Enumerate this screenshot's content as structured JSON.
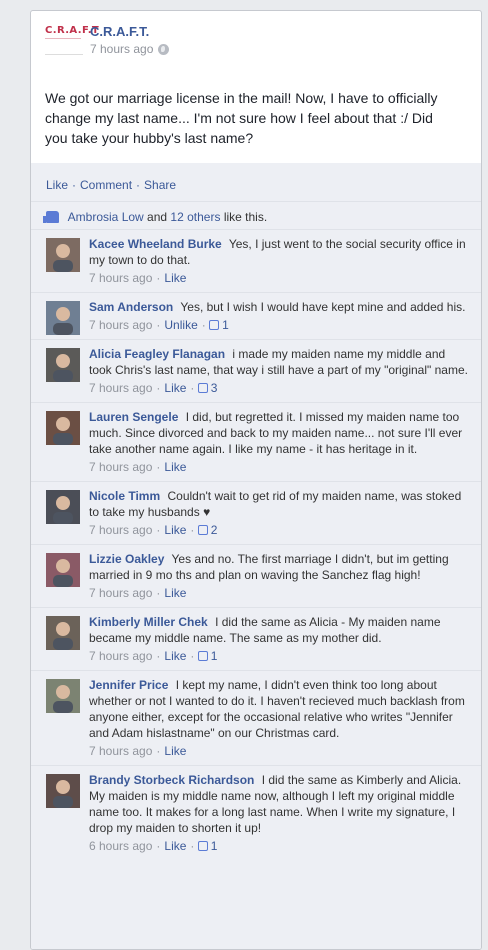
{
  "post": {
    "page_name": "C.R.A.F.T.",
    "logo_text": "C.R.A.F.T",
    "time": "7 hours ago",
    "text": "We got our marriage license in the mail! Now, I have to officially change my last name... I'm not sure how I feel about that :/ Did you take your hubby's last name?"
  },
  "actions": {
    "like": "Like",
    "comment": "Comment",
    "share": "Share",
    "dot": "·"
  },
  "likes": {
    "first": "Ambrosia Low",
    "and": "and",
    "others": "12 others",
    "suffix": "like this."
  },
  "comments": [
    {
      "name": "Kacee Wheeland Burke",
      "text": "Yes, I just went to the social security office in my town to do that.",
      "time": "7 hours ago",
      "action": "Like",
      "likes": ""
    },
    {
      "name": "Sam Anderson",
      "text": "Yes, but I wish I would have kept mine and added his.",
      "time": "7 hours ago",
      "action": "Unlike",
      "likes": "1"
    },
    {
      "name": "Alicia Feagley Flanagan",
      "text": "i made my maiden name my middle and took Chris's last name, that way i still have a part of my \"original\" name.",
      "time": "7 hours ago",
      "action": "Like",
      "likes": "3"
    },
    {
      "name": "Lauren Sengele",
      "text": "I did, but regretted it. I missed my maiden name too much. Since divorced and back to my maiden name... not sure I'll ever take another name again. I like my name - it has heritage in it.",
      "time": "7 hours ago",
      "action": "Like",
      "likes": ""
    },
    {
      "name": "Nicole Timm",
      "text": "Couldn't wait to get rid of my maiden name, was stoked to take my husbands ♥",
      "time": "7 hours ago",
      "action": "Like",
      "likes": "2"
    },
    {
      "name": "Lizzie Oakley",
      "text": "Yes and no. The first marriage I didn't, but im getting married in 9 mo ths and plan on waving the Sanchez flag high!",
      "time": "7 hours ago",
      "action": "Like",
      "likes": ""
    },
    {
      "name": "Kimberly Miller Chek",
      "text": "I did the same as Alicia - My maiden name became my middle name. The same as my mother did.",
      "time": "7 hours ago",
      "action": "Like",
      "likes": "1"
    },
    {
      "name": "Jennifer Price",
      "text": "I kept my name, I didn't even think too long about whether or not I wanted to do it. I haven't recieved much backlash from anyone either, except for the occasional relative who writes \"Jennifer and Adam hislastname\" on our Christmas card.",
      "time": "7 hours ago",
      "action": "Like",
      "likes": ""
    },
    {
      "name": "Brandy Storbeck Richardson",
      "text": "I did the same as Kimberly and Alicia. My maiden is my middle name now, although I left my original middle name too. It makes for a long last name. When I write my signature, I drop my maiden to shorten it up!",
      "time": "6 hours ago",
      "action": "Like",
      "likes": "1"
    }
  ],
  "colors": {
    "link": "#3b5998",
    "meta": "#90949c",
    "feedback_bg": "#edeff4",
    "logo": "#c0304a"
  }
}
